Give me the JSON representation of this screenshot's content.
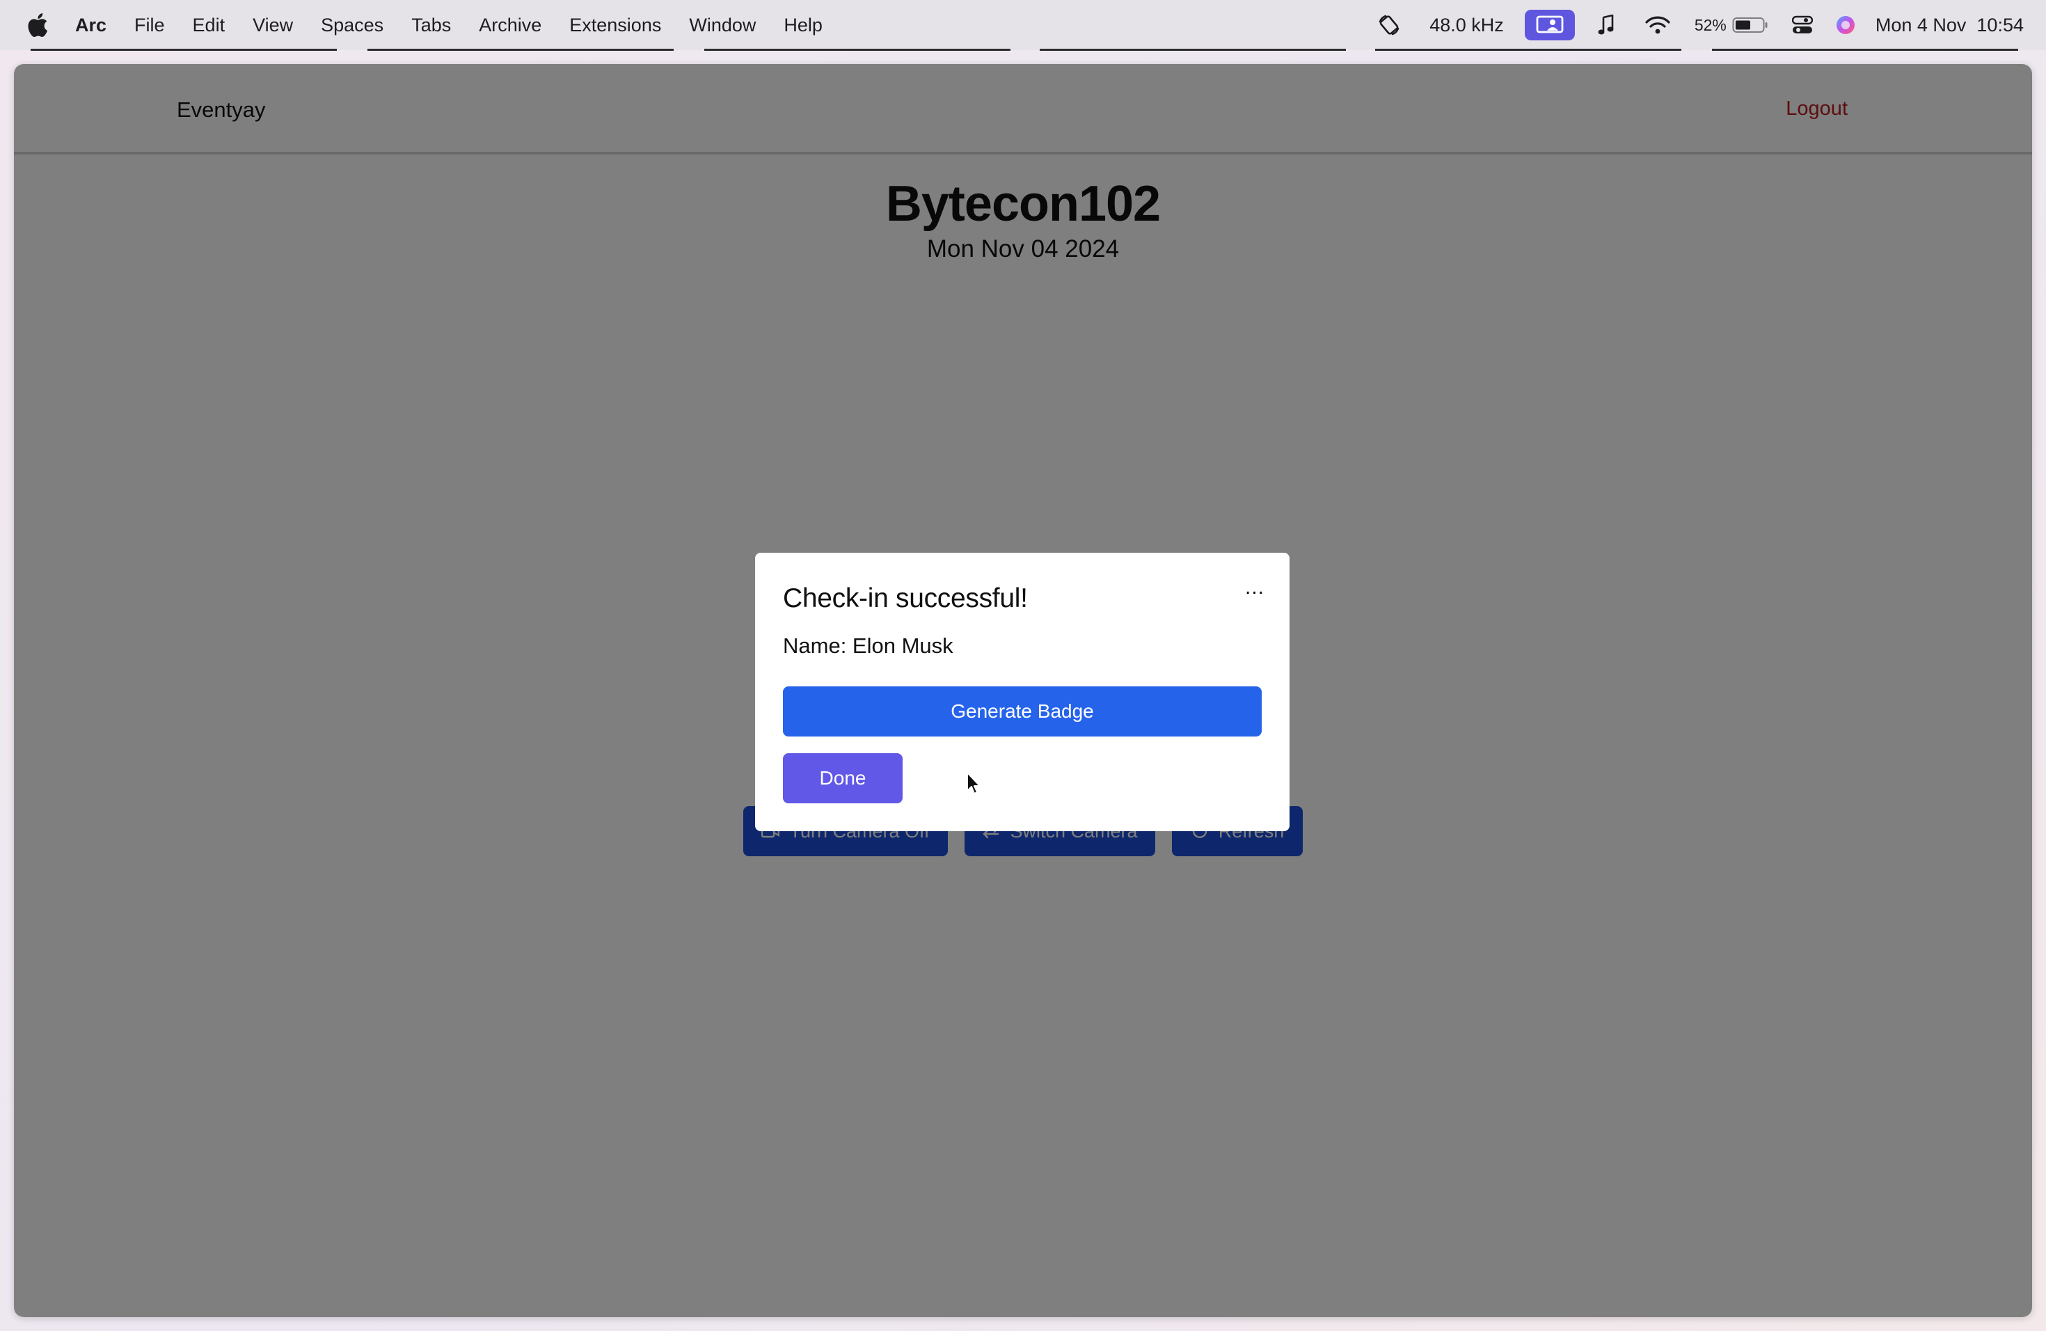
{
  "menubar": {
    "app_name": "Arc",
    "items": [
      "File",
      "Edit",
      "View",
      "Spaces",
      "Tabs",
      "Archive",
      "Extensions",
      "Window",
      "Help"
    ],
    "audio_rate": "48.0 kHz",
    "battery_percent": "52%",
    "datetime": "Mon 4 Nov  10:54",
    "accent_color": "#5f56e0"
  },
  "navbar": {
    "brand": "Eventyay",
    "logout_label": "Logout"
  },
  "event": {
    "title": "Bytecon102",
    "date": "Mon Nov 04 2024"
  },
  "camera_controls": {
    "turn_camera_off": "Turn Camera Off",
    "switch_camera": "Switch Camera",
    "refresh": "Refresh"
  },
  "dialog": {
    "title": "Check-in successful!",
    "menu_label": "...",
    "name_line": "Name: Elon Musk",
    "generate_badge_label": "Generate Badge",
    "done_label": "Done"
  },
  "colors": {
    "primary_blue": "#2563eb",
    "done_purple": "#6158e8",
    "logout_red": "#b91c1c"
  }
}
